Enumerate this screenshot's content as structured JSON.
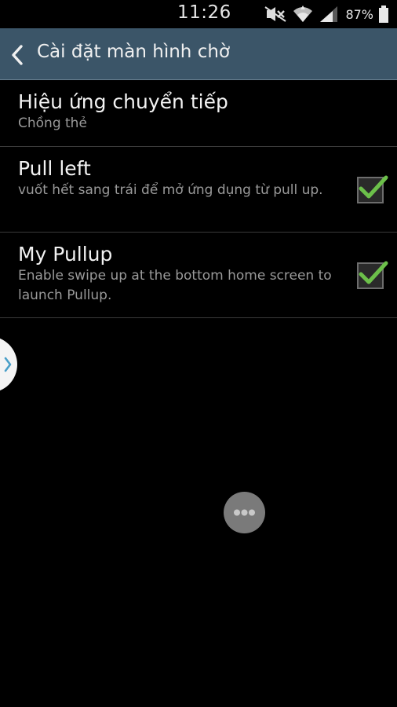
{
  "status_bar": {
    "time": "11:26",
    "battery_percent": "87%",
    "icons": [
      "mute-icon",
      "wifi-icon",
      "signal-icon",
      "battery-icon"
    ]
  },
  "action_bar": {
    "back_icon": "chevron-left-icon",
    "title": "Cài đặt màn hình chờ",
    "background_color": "#3b5568"
  },
  "settings": {
    "items": [
      {
        "title": "Hiệu ứng chuyển tiếp",
        "subtitle": "Chồng thẻ",
        "has_checkbox": false
      },
      {
        "title": "Pull left",
        "subtitle": "vuốt hết sang trái để mở ứng dụng từ pull up.",
        "has_checkbox": true,
        "checked": true
      },
      {
        "title": "My Pullup",
        "subtitle": "Enable swipe up at the bottom home screen to launch Pullup.",
        "has_checkbox": true,
        "checked": true
      }
    ]
  },
  "overlays": {
    "edge_handle_icon": "chevron-right-icon",
    "more_button_icon": "more-horizontal-icon"
  },
  "colors": {
    "check_green": "#6cc04a",
    "accent_blue": "#3b5568"
  }
}
